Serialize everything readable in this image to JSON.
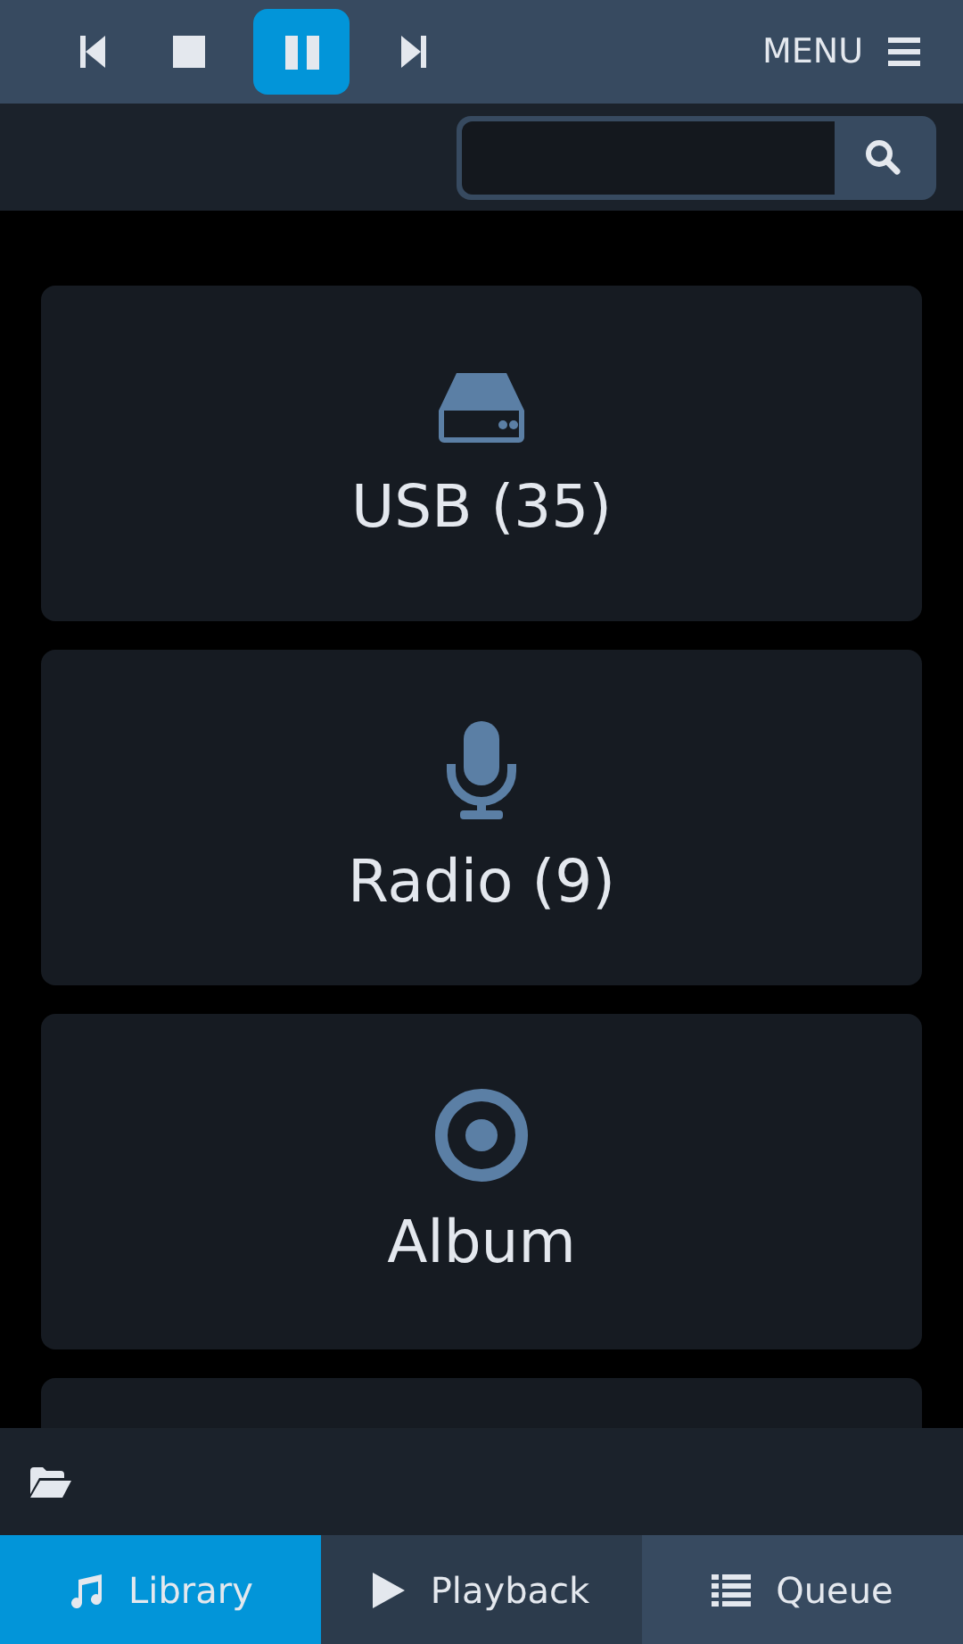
{
  "transport": [
    {
      "kind": "previous",
      "selected": false
    },
    {
      "kind": "stop",
      "selected": false
    },
    {
      "kind": "pause",
      "selected": true
    },
    {
      "kind": "next",
      "selected": false
    }
  ],
  "menu": {
    "label": "MENU"
  },
  "categories": [
    {
      "kind": "usb",
      "label": "USB (35)"
    },
    {
      "kind": "radio",
      "label": "Radio (9)"
    },
    {
      "kind": "album",
      "label": "Album"
    }
  ],
  "tabs": [
    {
      "kind": "library",
      "label": "Library",
      "selected": true
    },
    {
      "kind": "playback",
      "label": "Playback",
      "selected": false
    },
    {
      "kind": "queue",
      "label": "Queue",
      "selected": false
    }
  ]
}
